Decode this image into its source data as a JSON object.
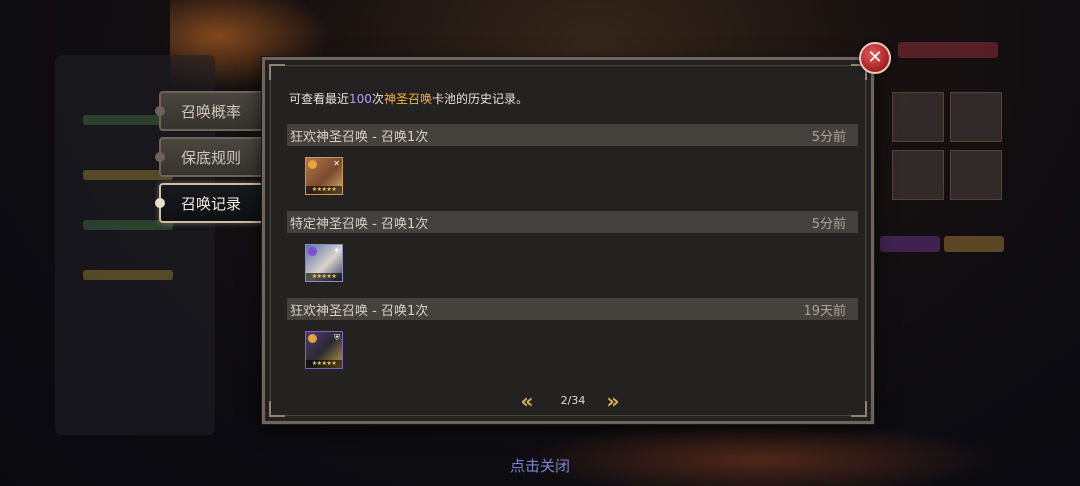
{
  "side_tabs": [
    {
      "label": "召唤概率",
      "active": false
    },
    {
      "label": "保底规则",
      "active": false
    },
    {
      "label": "召唤记录",
      "active": true
    }
  ],
  "modal": {
    "description": {
      "prefix": "可查看最近",
      "count": "100",
      "middle": "次",
      "pool": "神圣召唤",
      "suffix": "卡池的历史记录。"
    },
    "entries": [
      {
        "title": "狂欢神圣召唤 - 召唤1次",
        "time": "5分前",
        "hero": {
          "frame": "gold",
          "element_color": "#e8a23a",
          "class_icon": "sword-icon",
          "stars": "★★★★★"
        }
      },
      {
        "title": "特定神圣召唤 - 召唤1次",
        "time": "5分前",
        "hero": {
          "frame": "blue",
          "element_color": "#7a4ed8",
          "class_icon": "star-icon",
          "stars": "★★★★★"
        }
      },
      {
        "title": "狂欢神圣召唤 - 召唤1次",
        "time": "19天前",
        "hero": {
          "frame": "purple",
          "element_color": "#e8a23a",
          "class_icon": "shield-icon",
          "stars": "★★★★★"
        }
      }
    ],
    "pager": {
      "text": "2/34",
      "current": 2,
      "total": 34
    }
  },
  "footer": {
    "tap_close": "点击关闭"
  },
  "colors": {
    "accent_purple": "#b49dfc",
    "accent_gold": "#f0b63c",
    "close_red": "#a41f22"
  }
}
